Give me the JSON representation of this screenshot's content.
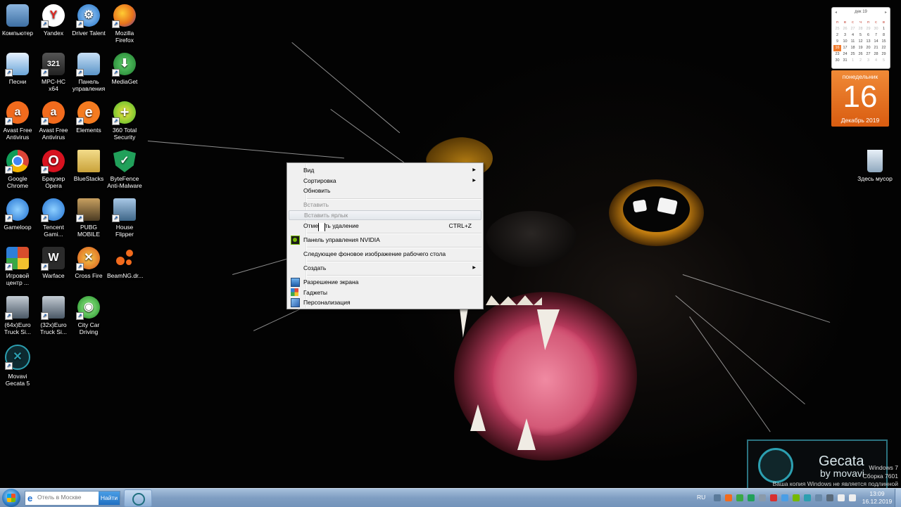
{
  "desktop_icons": [
    {
      "label": "Компьютер",
      "name": "computer",
      "color": "#4a7fb5"
    },
    {
      "label": "Yandex",
      "name": "yandex",
      "color": "#e52620",
      "glyph": "Y"
    },
    {
      "label": "Driver Talent",
      "name": "driver-talent",
      "color": "#2e8ad8"
    },
    {
      "label": "Mozilla Firefox",
      "name": "firefox",
      "color": "#e8731c"
    },
    {
      "label": "Песни",
      "name": "songs",
      "color": "#6aa5d8"
    },
    {
      "label": "MPC-HC x64",
      "name": "mpc-hc",
      "color": "#3a3a3a"
    },
    {
      "label": "Панель управления",
      "name": "control-panel",
      "color": "#5a94c8"
    },
    {
      "label": "MediaGet",
      "name": "mediaget",
      "color": "#2e9a3e"
    },
    {
      "label": "Avast Free Antivirus",
      "name": "avast-1",
      "color": "#f26b1d"
    },
    {
      "label": "Avast Free Antivirus",
      "name": "avast-2",
      "color": "#f26b1d"
    },
    {
      "label": "Elements",
      "name": "elements",
      "color": "#f47b20",
      "glyph": "e"
    },
    {
      "label": "360 Total Security",
      "name": "360-security",
      "color": "#4bb82b",
      "glyph": "+"
    },
    {
      "label": "Google Chrome",
      "name": "chrome",
      "color": "#3c8d3f"
    },
    {
      "label": "Браузер Opera",
      "name": "opera",
      "color": "#d7121f",
      "glyph": "O"
    },
    {
      "label": "BlueStacks",
      "name": "bluestacks",
      "color": "#d7b848"
    },
    {
      "label": "ByteFence Anti-Malware",
      "name": "bytefence",
      "color": "#21a05a"
    },
    {
      "label": "Gameloop",
      "name": "gameloop",
      "color": "#2e8fe0"
    },
    {
      "label": "Tencent Gami...",
      "name": "tencent",
      "color": "#2e8fe0"
    },
    {
      "label": "PUBG MOBILE",
      "name": "pubg",
      "color": "#8a7448"
    },
    {
      "label": "House Flipper",
      "name": "house-flipper",
      "color": "#5c84a8"
    },
    {
      "label": "Игровой центр ...",
      "name": "game-center",
      "color": "#d84d2c"
    },
    {
      "label": "Warface",
      "name": "warface",
      "color": "#2b2b2b",
      "glyph": "W"
    },
    {
      "label": "Cross Fire",
      "name": "crossfire",
      "color": "#d8561a"
    },
    {
      "label": "BeamNG.dr...",
      "name": "beamng",
      "color": "#f26b1d"
    },
    {
      "label": "(64x)Euro Truck Si...",
      "name": "ets-64",
      "color": "#5a6a7a"
    },
    {
      "label": "(32x)Euro Truck Si...",
      "name": "ets-32",
      "color": "#5a6a7a"
    },
    {
      "label": "City Car Driving",
      "name": "city-car-driving",
      "color": "#3fb53a"
    },
    {
      "label": "Movavi Gecata 5",
      "name": "gecata",
      "color": "#2c7f8f"
    },
    {
      "label": "Здесь мусор",
      "name": "recycle-bin",
      "color": "#8fa8be"
    }
  ],
  "context_menu": {
    "items": [
      {
        "label": "Вид",
        "submenu": true
      },
      {
        "label": "Сортировка",
        "submenu": true
      },
      {
        "label": "Обновить"
      },
      {
        "label": "Вставить",
        "disabled": true
      },
      {
        "label": "Вставить ярлык",
        "disabled": true
      },
      {
        "label": "Отменить удаление",
        "shortcut": "CTRL+Z"
      },
      {
        "label": "Панель управления NVIDIA",
        "icon": "nvidia-icon"
      },
      {
        "label": "Следующее фоновое изображение рабочего стола"
      },
      {
        "label": "Создать",
        "submenu": true
      },
      {
        "label": "Разрешение экрана",
        "icon": "display-icon"
      },
      {
        "label": "Гаджеты",
        "icon": "gadgets-icon"
      },
      {
        "label": "Персонализация",
        "icon": "personalize-icon"
      }
    ]
  },
  "calendar": {
    "month_header": "дек 19",
    "weekdays": [
      "п",
      "в",
      "с",
      "ч",
      "п",
      "с",
      "в"
    ],
    "days": [
      "25",
      "26",
      "27",
      "28",
      "29",
      "30",
      "1",
      "2",
      "3",
      "4",
      "5",
      "6",
      "7",
      "8",
      "9",
      "10",
      "11",
      "12",
      "13",
      "14",
      "15",
      "16",
      "17",
      "18",
      "19",
      "20",
      "21",
      "22",
      "23",
      "24",
      "25",
      "26",
      "27",
      "28",
      "29",
      "30",
      "31",
      "1",
      "2",
      "3",
      "4",
      "5"
    ],
    "today_index": 21,
    "weekday_full": "понедельник",
    "day": "16",
    "month_year": "Декабрь 2019"
  },
  "taskbar": {
    "search_placeholder": "Отель в Москве",
    "search_button": "Найти",
    "language": "RU",
    "time": "13:09",
    "date": "16.12.2019"
  },
  "watermark": {
    "brand": "Gecata",
    "by": "by movavi",
    "windows_line1": "Windows 7",
    "windows_line2": "Сборка 7601",
    "windows_notice": "Ваша копия Windows не является подлинной"
  }
}
